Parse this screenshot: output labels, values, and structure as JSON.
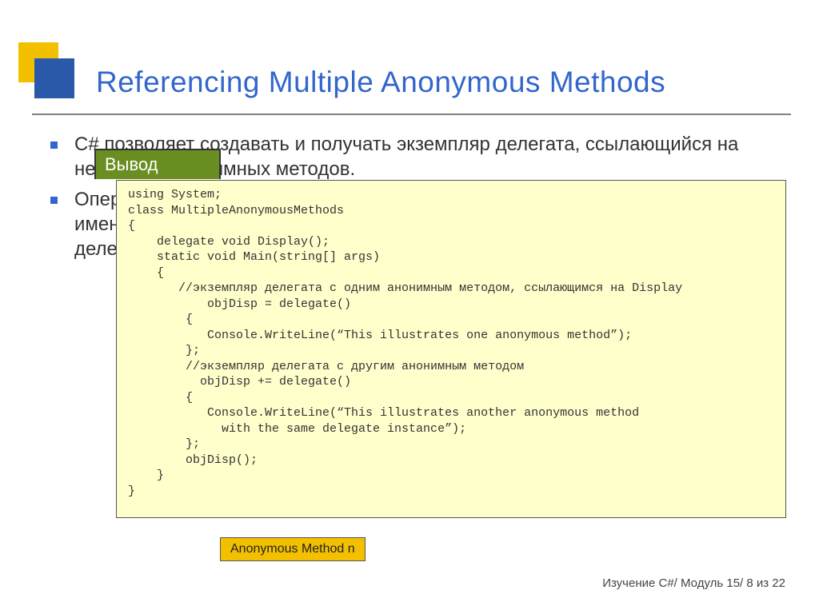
{
  "slide": {
    "title": "Referencing Multiple Anonymous Methods"
  },
  "bullets": [
    "C# позволяет создавать и получать экземпляр делегата, ссылающийся на несколько анонимных методов.",
    "Оператор \"+=\" используется для добавления дополнительных ссылок, как на именованные, так и на анонимные методы, после создания экземпляра делегата."
  ],
  "output_label": "Вывод",
  "code": "using System;\nclass MultipleAnonymousMethods\n{\n    delegate void Display();\n    static void Main(string[] args)\n    {\n       //экземпляр делегата с одним анонимным методом, ссылающимся на Display\n           objDisp = delegate()\n        {\n           Console.WriteLine(“This illustrates one anonymous method”);\n        };\n        //экземпляр делегата с другим анонимным методом\n          objDisp += delegate()\n        {\n           Console.WriteLine(“This illustrates another anonymous method\n             with the same delegate instance”);\n        };\n        objDisp();\n    }\n}",
  "diagram_caption": "Anonymous Method n",
  "footer": "Изучение C#/ Модуль 15/ 8 из 22"
}
